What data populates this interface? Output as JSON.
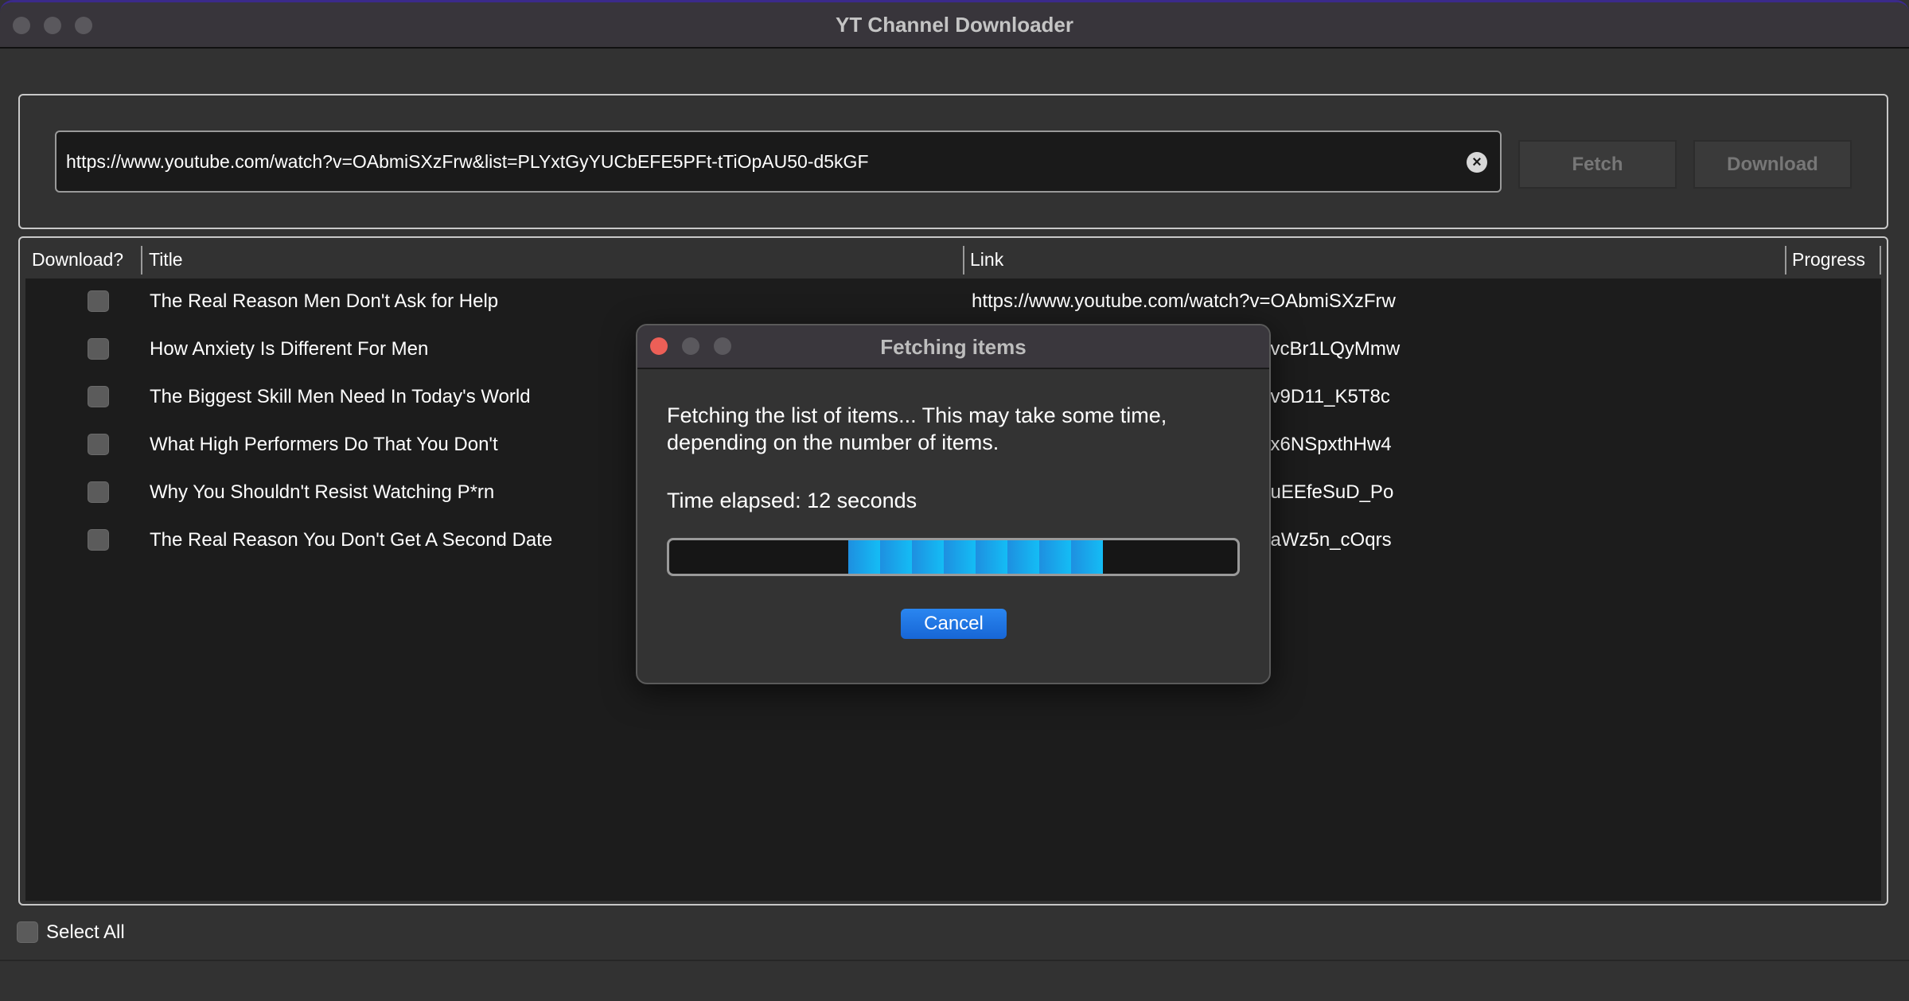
{
  "window": {
    "title": "YT Channel Downloader"
  },
  "url_input": {
    "value": "https://www.youtube.com/watch?v=OAbmiSXzFrw&list=PLYxtGyYUCbEFE5PFt-tTiOpAU50-d5kGF"
  },
  "buttons": {
    "fetch": "Fetch",
    "download": "Download"
  },
  "table": {
    "headers": [
      "Download?",
      "Title",
      "Link",
      "Progress"
    ],
    "rows": [
      {
        "title": "The Real Reason Men Don't Ask for Help",
        "link": "https://www.youtube.com/watch?v=OAbmiSXzFrw"
      },
      {
        "title": "How Anxiety Is Different For Men",
        "link": "https://www.youtube.com/watch?v=vcBr1LQyMmw"
      },
      {
        "title": "The Biggest Skill Men Need In Today's World",
        "link": "https://www.youtube.com/watch?v=v9D11_K5T8c"
      },
      {
        "title": "What High Performers Do That You Don't",
        "link": "https://www.youtube.com/watch?v=x6NSpxthHw4"
      },
      {
        "title": "Why You Shouldn't Resist Watching P*rn",
        "link": "https://www.youtube.com/watch?v=uEEfeSuD_Po"
      },
      {
        "title": "The Real Reason You Don't Get A Second Date",
        "link": "https://www.youtube.com/watch?v=aWz5n_cOqrs"
      }
    ]
  },
  "select_all": "Select All",
  "dialog": {
    "title": "Fetching items",
    "message_line1": "Fetching the list of items... This may take some time,",
    "message_line2": "depending on the number of items.",
    "elapsed": "Time elapsed: 12 seconds",
    "cancel": "Cancel"
  },
  "colors": {
    "accent": "#1f74e6",
    "progress": "#14bdf5",
    "close": "#ec5f57"
  }
}
